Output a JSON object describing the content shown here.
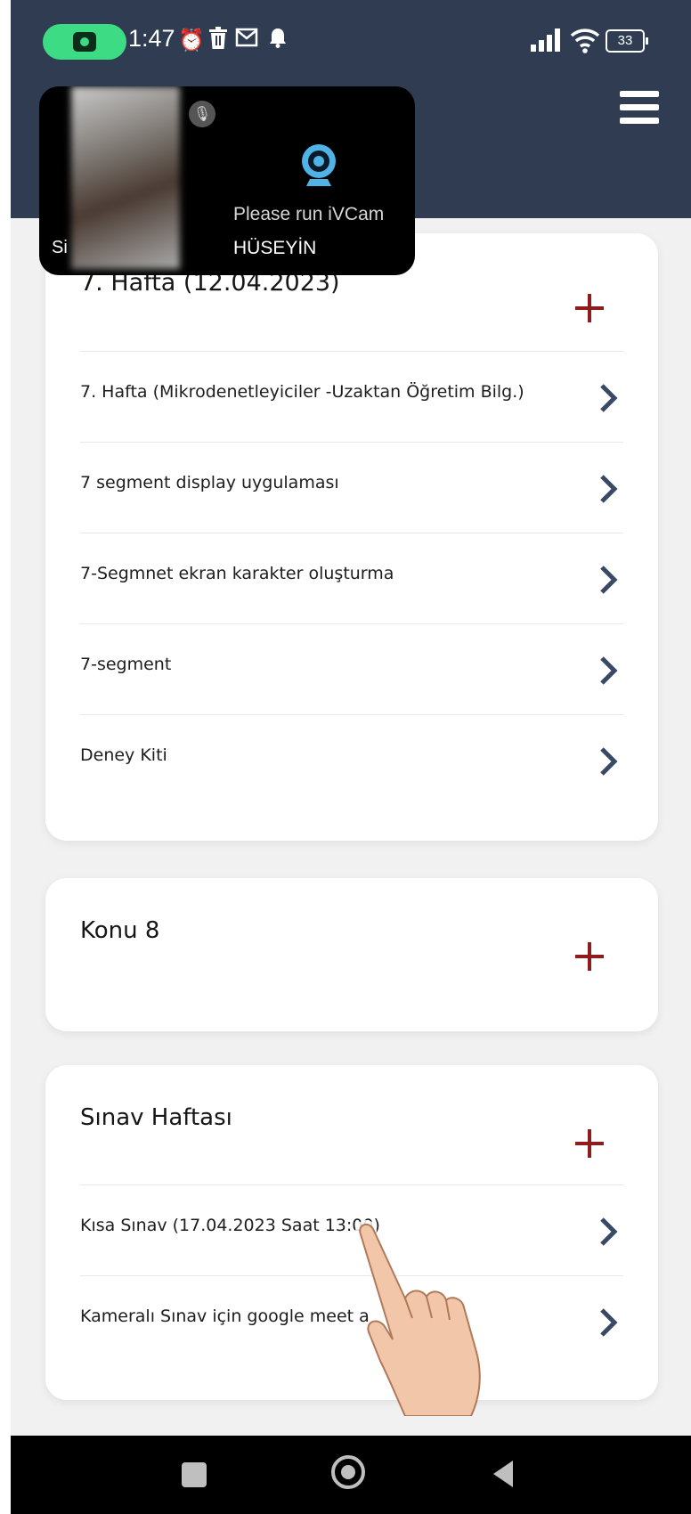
{
  "status_bar": {
    "time": "1:47",
    "battery": "33",
    "icons": [
      "screen-record-icon",
      "alarm-icon",
      "trash-icon",
      "gmail-icon",
      "notification-bell-icon",
      "signal-icon",
      "wifi-icon",
      "battery-icon"
    ]
  },
  "header": {
    "menu_icon": "hamburger-menu-icon",
    "background_color": "#2f3c52"
  },
  "video_overlay": {
    "left_label": "Si",
    "message": "Please run iVCam",
    "name": "HÜSEYİN",
    "icons": [
      "mic-muted-icon",
      "webcam-icon"
    ]
  },
  "sections": [
    {
      "title": "7. Hafta (12.04.2023)",
      "items": [
        {
          "label": "7. Hafta (Mikrodenetleyiciler -Uzaktan Öğretim Bilg.)"
        },
        {
          "label": "7 segment display uygulaması"
        },
        {
          "label": "7-Segmnet ekran karakter oluşturma"
        },
        {
          "label": "7-segment"
        },
        {
          "label": "Deney Kiti"
        }
      ]
    },
    {
      "title": "Konu 8",
      "items": []
    },
    {
      "title": "Sınav Haftası",
      "items": [
        {
          "label": "Kısa Sınav (17.04.2023 Saat 13:00)"
        },
        {
          "label": "Kameralı Sınav için google meet a"
        }
      ]
    }
  ],
  "colors": {
    "accent_plus": "#8e1c1c",
    "chevron": "#3a4a66",
    "card_background": "#ffffff",
    "page_background": "#f1f1f1"
  },
  "nav_bar": {
    "icons": [
      "recent-apps-icon",
      "home-icon",
      "back-icon"
    ]
  }
}
